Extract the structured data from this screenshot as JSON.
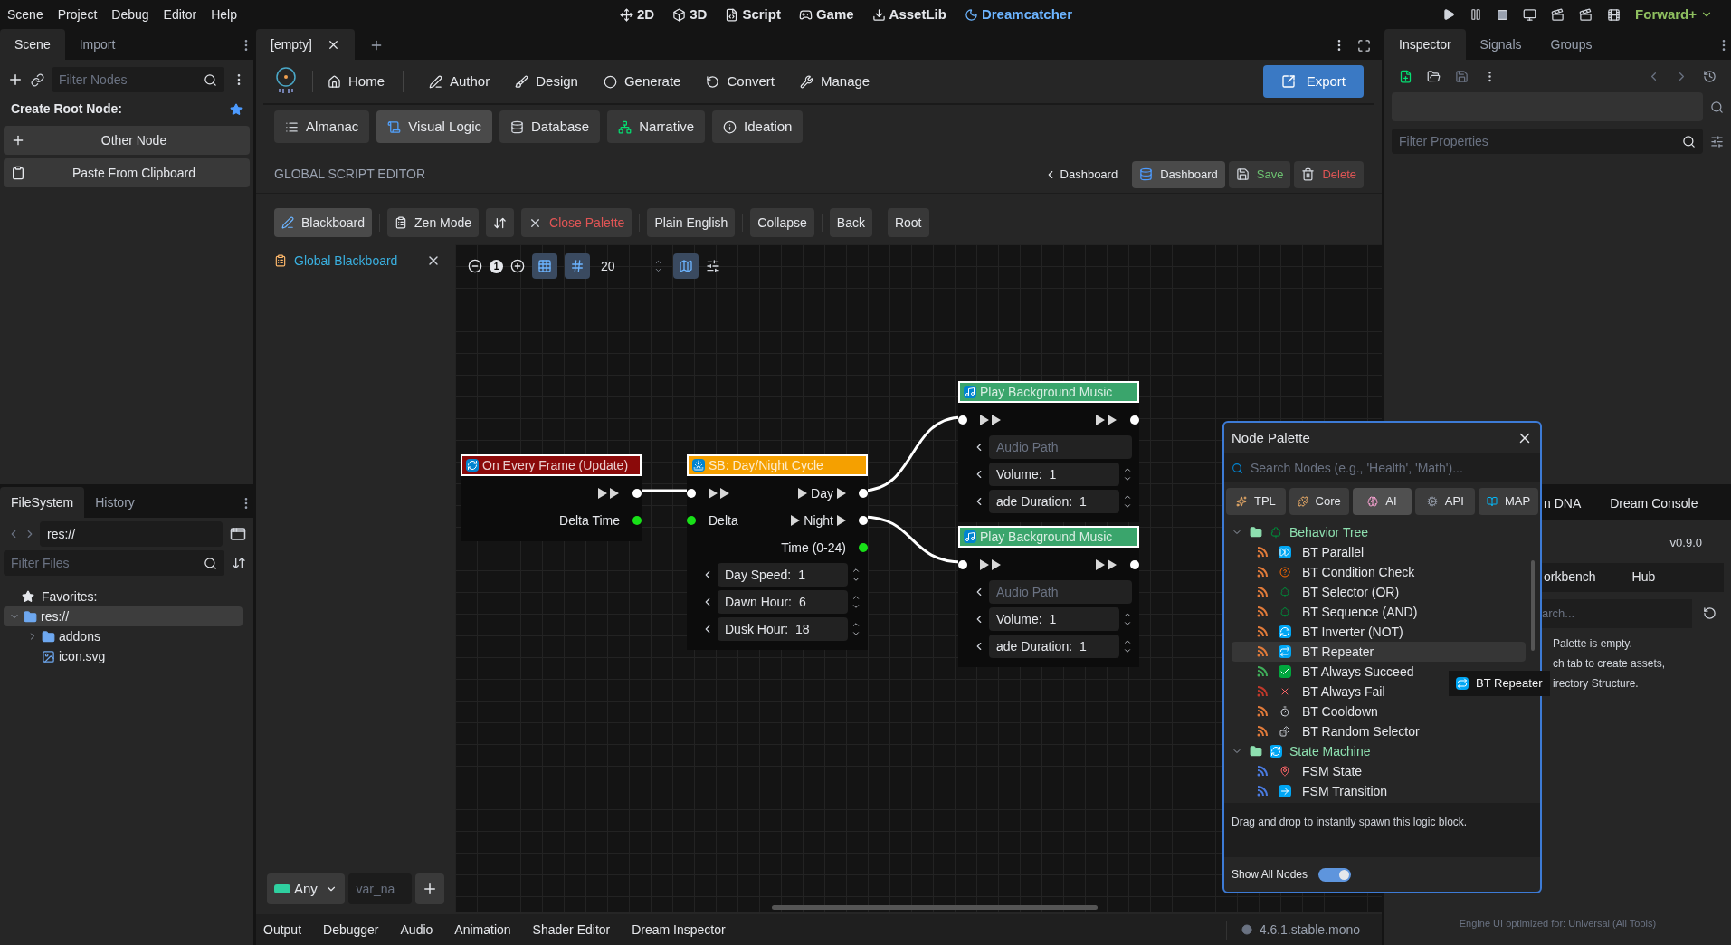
{
  "menu": [
    "Scene",
    "Project",
    "Debug",
    "Editor",
    "Help"
  ],
  "workspaces": [
    {
      "label": "2D",
      "selected": false
    },
    {
      "label": "3D",
      "selected": false
    },
    {
      "label": "Script",
      "selected": false
    },
    {
      "label": "Game",
      "selected": false
    },
    {
      "label": "AssetLib",
      "selected": false
    },
    {
      "label": "Dreamcatcher",
      "selected": true
    }
  ],
  "renderer": "Forward+",
  "scene_dock": {
    "tabs": [
      {
        "label": "Scene",
        "selected": true
      },
      {
        "label": "Import",
        "selected": false
      }
    ],
    "filter_placeholder": "Filter Nodes",
    "heading": "Create Root Node:",
    "buttons": [
      "Other Node",
      "Paste From Clipboard"
    ]
  },
  "filesystem_dock": {
    "tabs": [
      {
        "label": "FileSystem",
        "selected": true
      },
      {
        "label": "History",
        "selected": false
      }
    ],
    "path": "res://",
    "filter_placeholder": "Filter Files",
    "favorites": "Favorites:",
    "tree": [
      {
        "label": "res://",
        "kind": "folder",
        "expanded": true,
        "selected": true,
        "children": [
          {
            "label": "addons",
            "kind": "folder",
            "expanded": false,
            "selected": false
          },
          {
            "label": "icon.svg",
            "kind": "file",
            "selected": false
          }
        ]
      }
    ]
  },
  "scene_tabs": [
    {
      "label": "[empty]",
      "selected": true
    }
  ],
  "app_nav": [
    "Home",
    "Author",
    "Design",
    "Generate",
    "Convert",
    "Manage"
  ],
  "export_button": "Export",
  "modules": [
    {
      "label": "Almanac",
      "selected": false
    },
    {
      "label": "Visual Logic",
      "selected": true
    },
    {
      "label": "Database",
      "selected": false
    },
    {
      "label": "Narrative",
      "selected": false
    },
    {
      "label": "Ideation",
      "selected": false
    }
  ],
  "editor": {
    "title": "GLOBAL SCRIPT EDITOR",
    "breadcrumb": "Dashboard",
    "actions": [
      {
        "label": "Dashboard",
        "kind": "primary"
      },
      {
        "label": "Save",
        "kind": "save"
      },
      {
        "label": "Delete",
        "kind": "delete"
      }
    ]
  },
  "toolbar": [
    {
      "label": "Blackboard",
      "kind": "toggle",
      "selected": true
    },
    {
      "label": "Zen Mode",
      "kind": "toggle",
      "selected": false
    },
    {
      "kind": "icon",
      "selected": false
    },
    {
      "label": "Close Palette",
      "kind": "danger",
      "selected": false
    },
    {
      "label": "Plain English",
      "kind": "text",
      "selected": false
    },
    {
      "label": "Collapse",
      "kind": "text",
      "selected": false
    },
    {
      "label": "Back",
      "kind": "text",
      "selected": false
    },
    {
      "label": "Root",
      "kind": "text",
      "selected": false
    }
  ],
  "blackboard": {
    "title": "Global Blackboard",
    "type_select": "Any",
    "name_placeholder": "var_na"
  },
  "graph_toolbar": {
    "zoom_reset": "1",
    "grid": true,
    "snap": true,
    "snap_step": "20",
    "minimap": true
  },
  "nodes": [
    {
      "title": "On Every Frame (Update)",
      "color": "#8b0a0a",
      "rows": [
        {
          "kind": "ports",
          "right": {
            "kind": "flow"
          }
        },
        {
          "kind": "ports",
          "right": {
            "kind": "data",
            "label": "Delta Time"
          }
        }
      ]
    },
    {
      "title": "SB: Day/Night Cycle",
      "color": "#f5a000",
      "rows": [
        {
          "kind": "ports",
          "left": {
            "kind": "flow"
          },
          "right": {
            "kind": "flow",
            "label": "Day"
          }
        },
        {
          "kind": "ports",
          "left": {
            "kind": "data",
            "label": "Delta"
          },
          "right": {
            "kind": "flow",
            "label": "Night"
          }
        },
        {
          "kind": "ports",
          "right": {
            "kind": "data",
            "label": "Time (0-24)"
          }
        },
        {
          "kind": "field",
          "label": "Day Speed:",
          "value": "1"
        },
        {
          "kind": "field",
          "label": "Dawn Hour:",
          "value": "6"
        },
        {
          "kind": "field",
          "label": "Dusk Hour:",
          "value": "18"
        }
      ]
    },
    {
      "title": "Play Background Music",
      "color": "#3aa56c",
      "rows": [
        {
          "kind": "ports",
          "left": {
            "kind": "flow"
          },
          "right": {
            "kind": "flow"
          }
        },
        {
          "kind": "text",
          "placeholder": "Audio Path"
        },
        {
          "kind": "field",
          "label": "Volume:",
          "value": "1"
        },
        {
          "kind": "field",
          "label": "ade Duration:",
          "value": "1"
        }
      ]
    },
    {
      "title": "Play Background Music",
      "color": "#3aa56c",
      "rows": [
        {
          "kind": "ports",
          "left": {
            "kind": "flow"
          },
          "right": {
            "kind": "flow"
          }
        },
        {
          "kind": "text",
          "placeholder": "Audio Path"
        },
        {
          "kind": "field",
          "label": "Volume:",
          "value": "1"
        },
        {
          "kind": "field",
          "label": "ade Duration:",
          "value": "1"
        }
      ]
    }
  ],
  "bottom_tabs": [
    "Output",
    "Debugger",
    "Audio",
    "Animation",
    "Shader Editor",
    "Dream Inspector"
  ],
  "version": "4.6.1.stable.mono",
  "inspector": {
    "tabs": [
      {
        "label": "Inspector",
        "selected": true
      },
      {
        "label": "Signals",
        "selected": false
      },
      {
        "label": "Groups",
        "selected": false
      }
    ],
    "filter_placeholder": "Filter Properties"
  },
  "dream_dock": {
    "tabs": [
      "n DNA",
      "Dream Console"
    ],
    "version": "v0.9.0",
    "subtabs": [
      "orkbench",
      "Hub"
    ],
    "search_placeholder": "arch...",
    "messages": [
      "Palette is empty.",
      "ch tab to create assets,",
      "irectory Structure."
    ],
    "footer": "Engine UI optimized for: Universal (All Tools)"
  },
  "palette": {
    "title": "Node Palette",
    "search_placeholder": "Search Nodes (e.g., 'Health', 'Math')...",
    "filters": [
      {
        "label": "TPL",
        "selected": false
      },
      {
        "label": "Core",
        "selected": false
      },
      {
        "label": "AI",
        "selected": true
      },
      {
        "label": "API",
        "selected": false
      },
      {
        "label": "MAP",
        "selected": false
      }
    ],
    "tree": [
      {
        "label": "Behavior Tree",
        "expanded": true,
        "children": [
          {
            "label": "BT Parallel",
            "color": "#e07a3a",
            "selected": false
          },
          {
            "label": "BT Condition Check",
            "color": "#e07a3a",
            "selected": false
          },
          {
            "label": "BT Selector (OR)",
            "color": "#e07a3a",
            "selected": false
          },
          {
            "label": "BT Sequence (AND)",
            "color": "#e07a3a",
            "selected": false
          },
          {
            "label": "BT Inverter (NOT)",
            "color": "#e07a3a",
            "selected": false
          },
          {
            "label": "BT Repeater",
            "color": "#e07a3a",
            "selected": true
          },
          {
            "label": "BT Always Succeed",
            "color": "#3fae5a",
            "selected": false
          },
          {
            "label": "BT Always Fail",
            "color": "#c0392b",
            "selected": false
          },
          {
            "label": "BT Cooldown",
            "color": "#e07a3a",
            "selected": false
          },
          {
            "label": "BT Random Selector",
            "color": "#e07a3a",
            "selected": false
          }
        ]
      },
      {
        "label": "State Machine",
        "expanded": true,
        "children": [
          {
            "label": "FSM State",
            "color": "#4a7be0",
            "selected": false
          },
          {
            "label": "FSM Transition",
            "color": "#4a7be0",
            "selected": false
          }
        ]
      }
    ],
    "hint": "Drag and drop to instantly spawn this logic block.",
    "show_all": {
      "label": "Show All Nodes",
      "on": true
    }
  },
  "drag_preview": {
    "label": "BT Repeater"
  }
}
